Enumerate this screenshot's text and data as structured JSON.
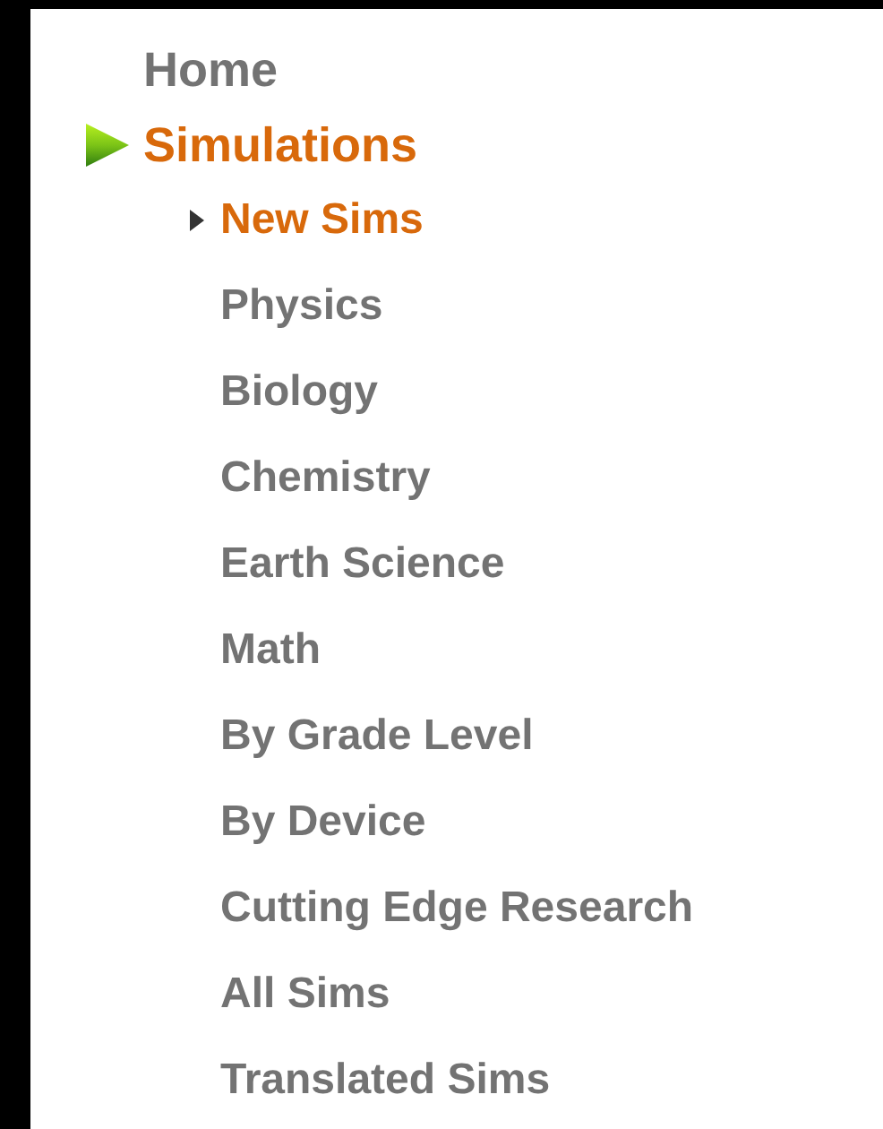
{
  "menu": [
    {
      "label": "Home",
      "selected": false
    },
    {
      "label": "Simulations",
      "selected": true,
      "children": [
        {
          "label": "New Sims",
          "selected": true
        },
        {
          "label": "Physics",
          "selected": false
        },
        {
          "label": "Biology",
          "selected": false
        },
        {
          "label": "Chemistry",
          "selected": false
        },
        {
          "label": "Earth Science",
          "selected": false
        },
        {
          "label": "Math",
          "selected": false
        },
        {
          "label": "By Grade Level",
          "selected": false
        },
        {
          "label": "By Device",
          "selected": false
        },
        {
          "label": "Cutting Edge Research",
          "selected": false
        },
        {
          "label": "All Sims",
          "selected": false
        },
        {
          "label": "Translated Sims",
          "selected": false
        }
      ]
    }
  ]
}
